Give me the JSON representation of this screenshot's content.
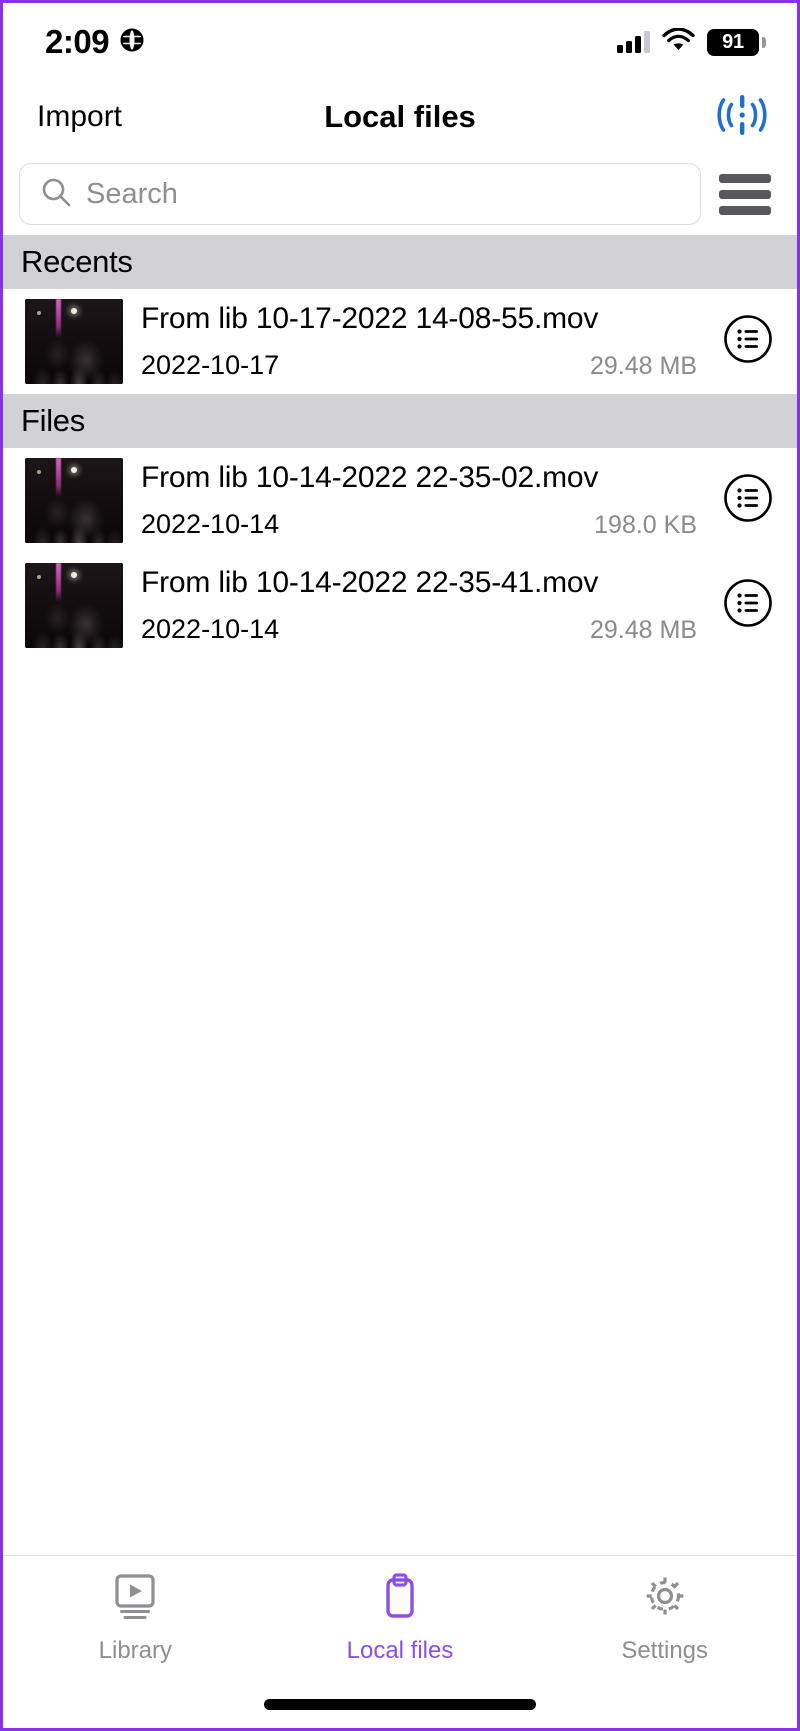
{
  "status_bar": {
    "time": "2:09",
    "location_icon": "globe-icon",
    "battery_percent": "91",
    "signal_icon": "cellular-signal-icon",
    "wifi_icon": "wifi-icon"
  },
  "nav_bar": {
    "left_button": "Import",
    "title": "Local files",
    "right_icon": "broadcast-cast-icon",
    "right_icon_color": "#1f6fd0"
  },
  "search": {
    "placeholder": "Search",
    "value": "",
    "search_icon": "search-icon",
    "menu_icon": "hamburger-menu-icon"
  },
  "sections": [
    {
      "title": "Recents",
      "files": [
        {
          "name": "From lib 10-17-2022 14-08-55.mov",
          "date": "2022-10-17",
          "size": "29.48 MB",
          "action_icon": "list-options-icon",
          "thumbnail": "video-thumbnail-dark-concert"
        }
      ]
    },
    {
      "title": "Files",
      "files": [
        {
          "name": "From lib 10-14-2022 22-35-02.mov",
          "date": "2022-10-14",
          "size": "198.0 KB",
          "action_icon": "list-options-icon",
          "thumbnail": "video-thumbnail-dark-concert"
        },
        {
          "name": "From lib 10-14-2022 22-35-41.mov",
          "date": "2022-10-14",
          "size": "29.48 MB",
          "action_icon": "list-options-icon",
          "thumbnail": "video-thumbnail-dark-concert"
        }
      ]
    }
  ],
  "tab_bar": {
    "active_color": "#8B4FE8",
    "inactive_color": "#8e8e93",
    "tabs": [
      {
        "label": "Library",
        "icon": "video-library-icon",
        "active": false
      },
      {
        "label": "Local files",
        "icon": "clipboard-files-icon",
        "active": true
      },
      {
        "label": "Settings",
        "icon": "gear-icon",
        "active": false
      }
    ]
  },
  "colors": {
    "section_header_bg": "#d1d1d6",
    "frame_border": "#8B2FE8",
    "cast_blue": "#1f6fd0",
    "size_text": "#8a8a8f"
  }
}
